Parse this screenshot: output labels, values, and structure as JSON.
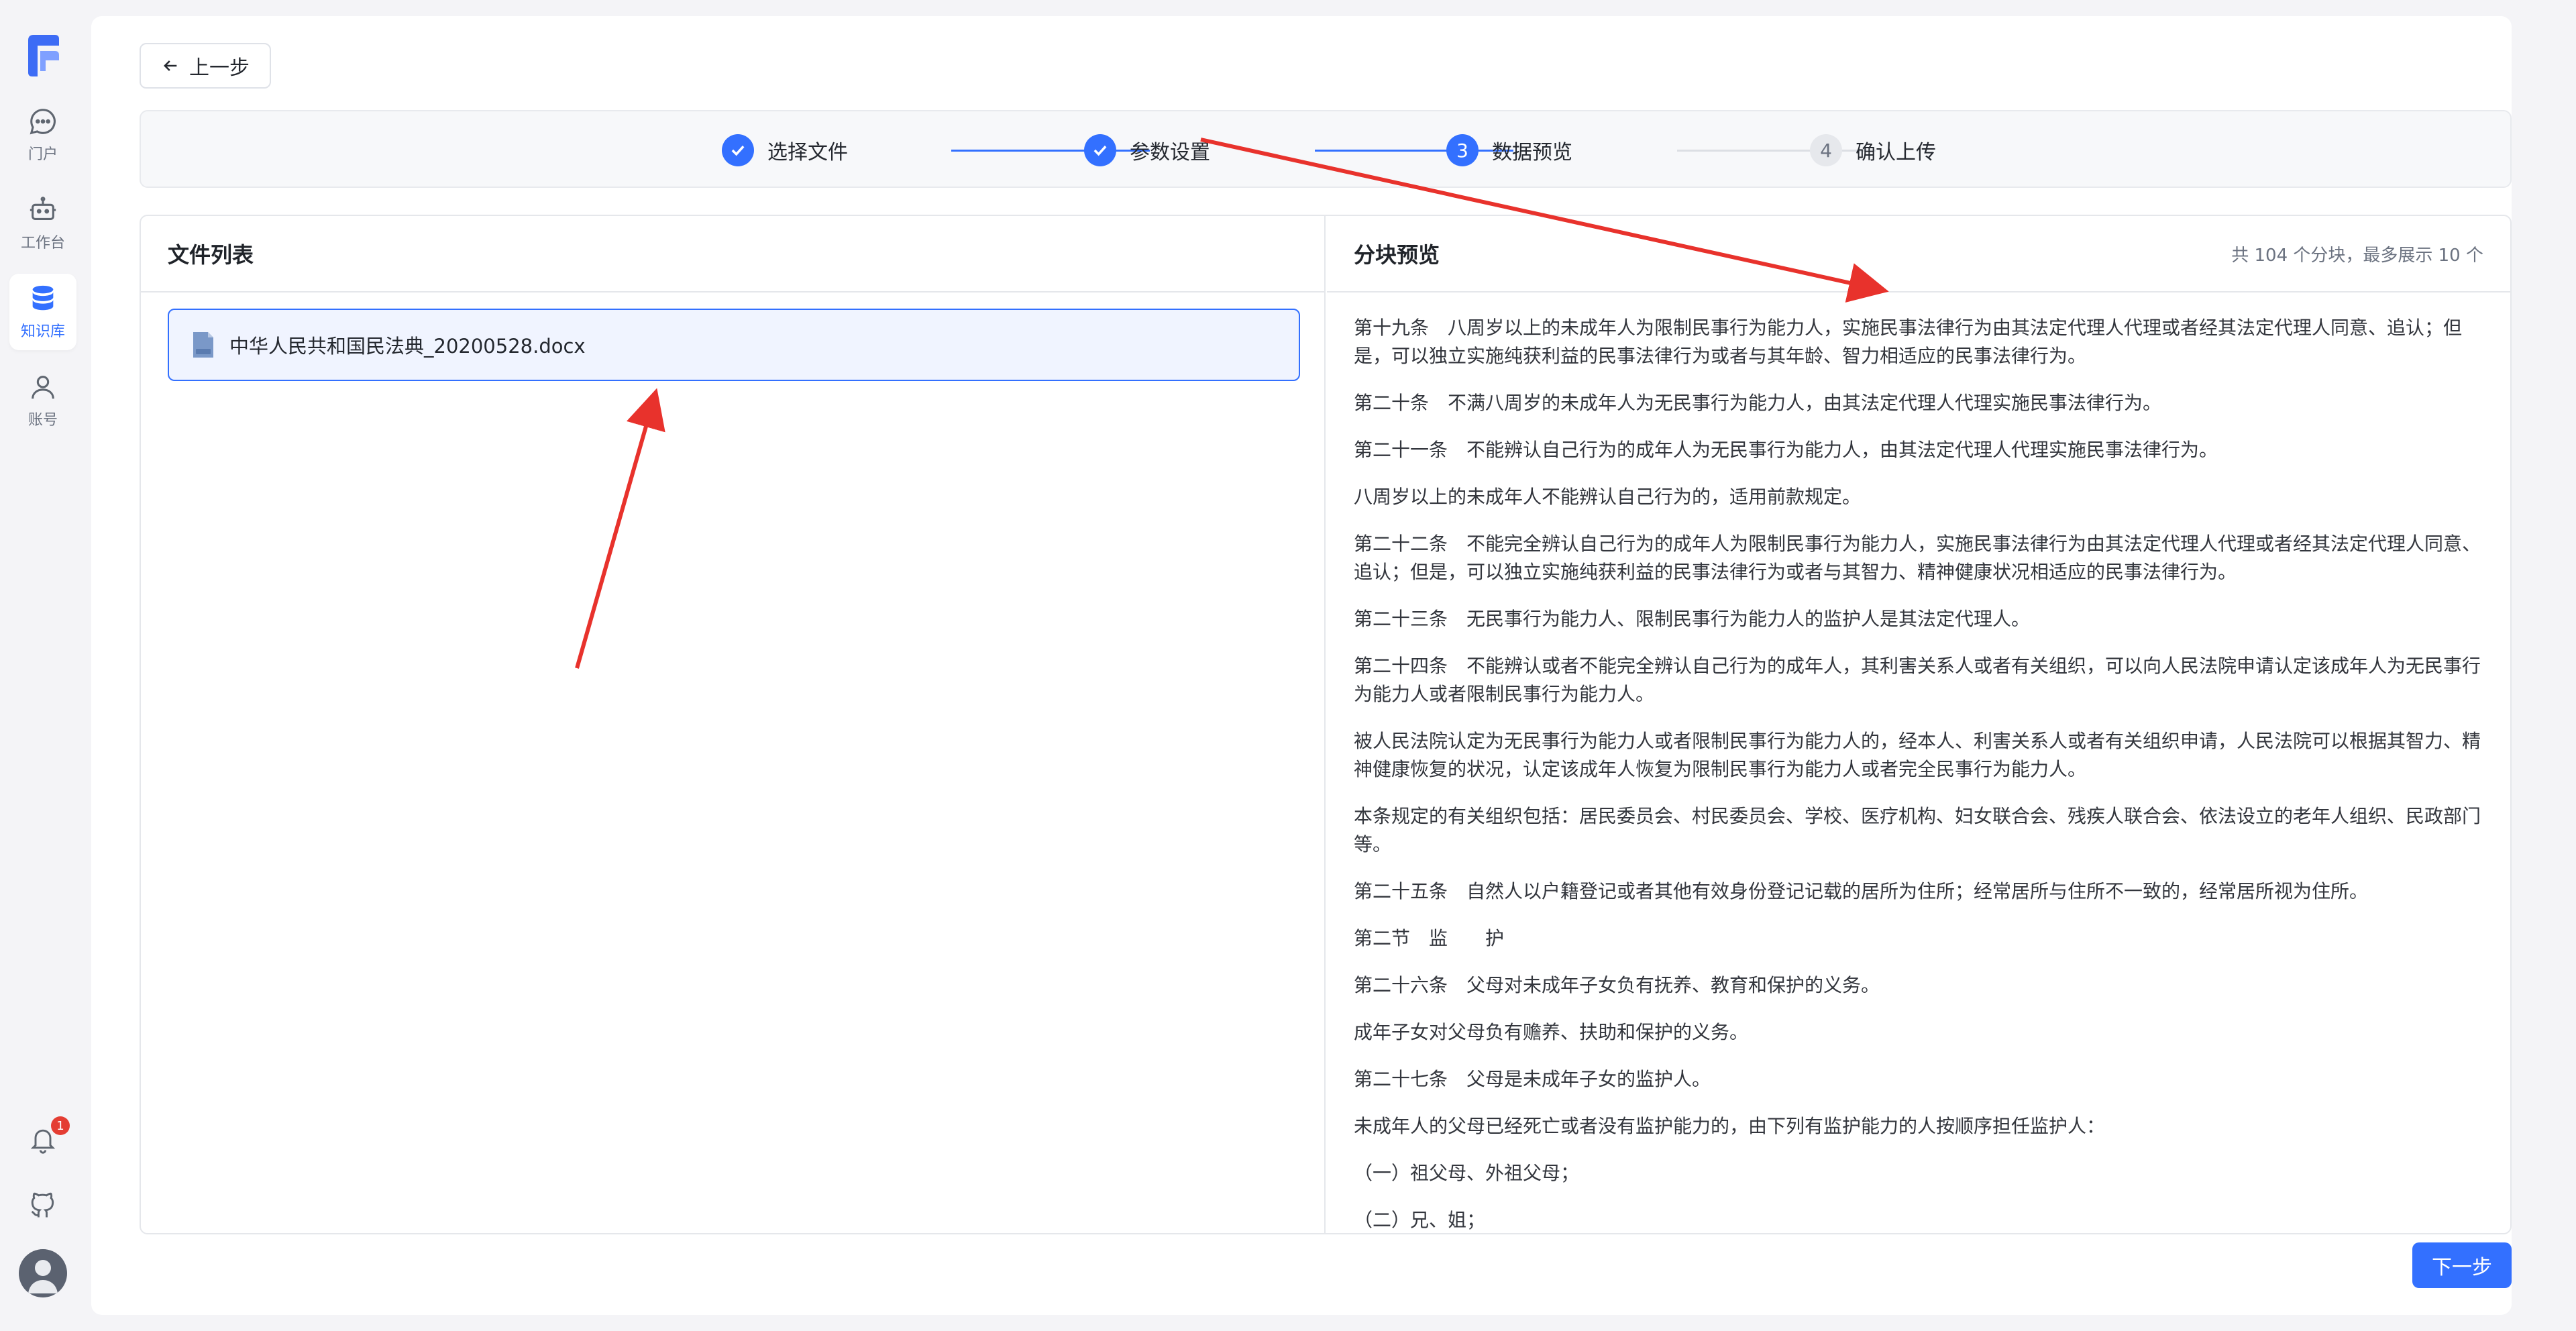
{
  "sidebar": {
    "items": [
      {
        "label": "门户",
        "icon": "chat-bubble-icon"
      },
      {
        "label": "工作台",
        "icon": "robot-icon"
      },
      {
        "label": "知识库",
        "icon": "database-icon",
        "active": true
      },
      {
        "label": "账号",
        "icon": "user-icon"
      }
    ],
    "notification_count": "1"
  },
  "toolbar": {
    "back_label": "上一步",
    "next_label": "下一步"
  },
  "stepper": {
    "steps": [
      {
        "label": "选择文件",
        "state": "done"
      },
      {
        "label": "参数设置",
        "state": "done"
      },
      {
        "label": "数据预览",
        "number": "3",
        "state": "current"
      },
      {
        "label": "确认上传",
        "number": "4",
        "state": "pending"
      }
    ]
  },
  "file_list": {
    "title": "文件列表",
    "files": [
      {
        "name": "中华人民共和国民法典_20200528.docx",
        "icon": "doc-file-icon"
      }
    ]
  },
  "chunk_preview": {
    "title": "分块预览",
    "meta": "共 104 个分块，最多展示 10 个",
    "paragraphs": [
      "第十九条　八周岁以上的未成年人为限制民事行为能力人，实施民事法律行为由其法定代理人代理或者经其法定代理人同意、追认；但是，可以独立实施纯获利益的民事法律行为或者与其年龄、智力相适应的民事法律行为。",
      "第二十条　不满八周岁的未成年人为无民事行为能力人，由其法定代理人代理实施民事法律行为。",
      "第二十一条　不能辨认自己行为的成年人为无民事行为能力人，由其法定代理人代理实施民事法律行为。",
      "八周岁以上的未成年人不能辨认自己行为的，适用前款规定。",
      "第二十二条　不能完全辨认自己行为的成年人为限制民事行为能力人，实施民事法律行为由其法定代理人代理或者经其法定代理人同意、追认；但是，可以独立实施纯获利益的民事法律行为或者与其智力、精神健康状况相适应的民事法律行为。",
      "第二十三条　无民事行为能力人、限制民事行为能力人的监护人是其法定代理人。",
      "第二十四条　不能辨认或者不能完全辨认自己行为的成年人，其利害关系人或者有关组织，可以向人民法院申请认定该成年人为无民事行为能力人或者限制民事行为能力人。",
      "被人民法院认定为无民事行为能力人或者限制民事行为能力人的，经本人、利害关系人或者有关组织申请，人民法院可以根据其智力、精神健康恢复的状况，认定该成年人恢复为限制民事行为能力人或者完全民事行为能力人。",
      "本条规定的有关组织包括：居民委员会、村民委员会、学校、医疗机构、妇女联合会、残疾人联合会、依法设立的老年人组织、民政部门等。",
      "第二十五条　自然人以户籍登记或者其他有效身份登记记载的居所为住所；经常居所与住所不一致的，经常居所视为住所。",
      "第二节　监　　护",
      "第二十六条　父母对未成年子女负有抚养、教育和保护的义务。",
      "成年子女对父母负有赡养、扶助和保护的义务。",
      "第二十七条　父母是未成年子女的监护人。",
      "未成年人的父母已经死亡或者没有监护能力的，由下列有监护能力的人按顺序担任监护人：",
      "（一）祖父母、外祖父母；",
      "（二）兄、姐；"
    ]
  },
  "colors": {
    "accent": "#3370ff",
    "annotation": "#e8322c",
    "badge": "#e43d33"
  }
}
